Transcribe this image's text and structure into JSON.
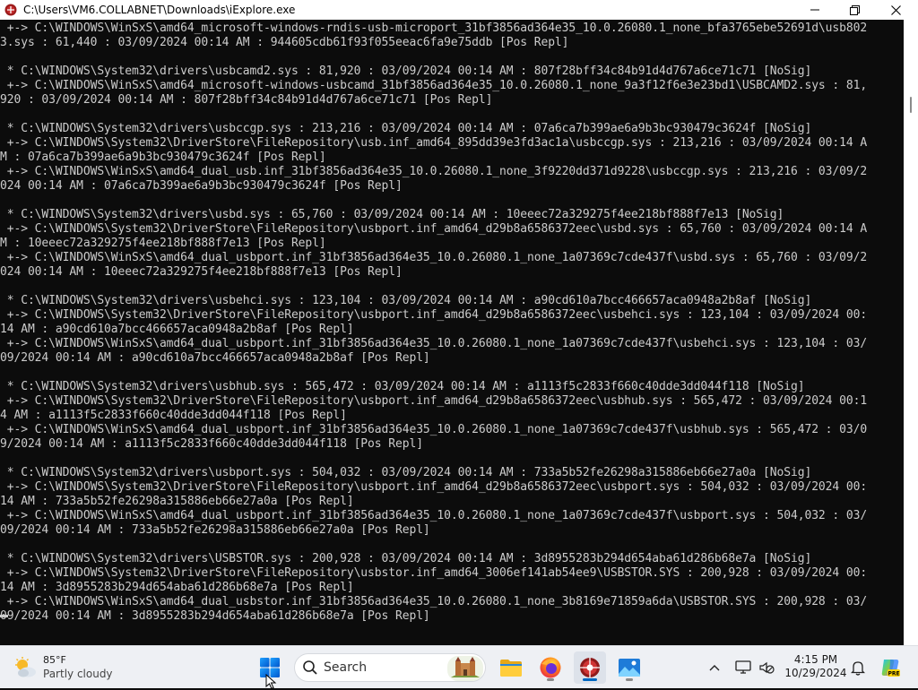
{
  "window": {
    "title": "C:\\Users\\VM6.COLLABNET\\Downloads\\iExplore.exe",
    "minimize_label": "minimize",
    "maximize_label": "maximize",
    "close_label": "close"
  },
  "console": {
    "lines": [
      " +-> C:\\WINDOWS\\WinSxS\\amd64_microsoft-windows-rndis-usb-microport_31bf3856ad364e35_10.0.26080.1_none_bfa3765ebe52691d\\usb802",
      "3.sys : 61,440 : 03/09/2024 00:14 AM : 944605cdb61f93f055eeac6fa9e75ddb [Pos Repl]",
      "",
      " * C:\\WINDOWS\\System32\\drivers\\usbcamd2.sys : 81,920 : 03/09/2024 00:14 AM : 807f28bff34c84b91d4d767a6ce71c71 [NoSig]",
      " +-> C:\\WINDOWS\\WinSxS\\amd64_microsoft-windows-usbcamd_31bf3856ad364e35_10.0.26080.1_none_9a3f12f6e3e23bd1\\USBCAMD2.sys : 81,",
      "920 : 03/09/2024 00:14 AM : 807f28bff34c84b91d4d767a6ce71c71 [Pos Repl]",
      "",
      " * C:\\WINDOWS\\System32\\drivers\\usbccgp.sys : 213,216 : 03/09/2024 00:14 AM : 07a6ca7b399ae6a9b3bc930479c3624f [NoSig]",
      " +-> C:\\WINDOWS\\System32\\DriverStore\\FileRepository\\usb.inf_amd64_895dd39e3fd3ac1a\\usbccgp.sys : 213,216 : 03/09/2024 00:14 A",
      "M : 07a6ca7b399ae6a9b3bc930479c3624f [Pos Repl]",
      " +-> C:\\WINDOWS\\WinSxS\\amd64_dual_usb.inf_31bf3856ad364e35_10.0.26080.1_none_3f9220dd371d9228\\usbccgp.sys : 213,216 : 03/09/2",
      "024 00:14 AM : 07a6ca7b399ae6a9b3bc930479c3624f [Pos Repl]",
      "",
      " * C:\\WINDOWS\\System32\\drivers\\usbd.sys : 65,760 : 03/09/2024 00:14 AM : 10eeec72a329275f4ee218bf888f7e13 [NoSig]",
      " +-> C:\\WINDOWS\\System32\\DriverStore\\FileRepository\\usbport.inf_amd64_d29b8a6586372eec\\usbd.sys : 65,760 : 03/09/2024 00:14 A",
      "M : 10eeec72a329275f4ee218bf888f7e13 [Pos Repl]",
      " +-> C:\\WINDOWS\\WinSxS\\amd64_dual_usbport.inf_31bf3856ad364e35_10.0.26080.1_none_1a07369c7cde437f\\usbd.sys : 65,760 : 03/09/2",
      "024 00:14 AM : 10eeec72a329275f4ee218bf888f7e13 [Pos Repl]",
      "",
      " * C:\\WINDOWS\\System32\\drivers\\usbehci.sys : 123,104 : 03/09/2024 00:14 AM : a90cd610a7bcc466657aca0948a2b8af [NoSig]",
      " +-> C:\\WINDOWS\\System32\\DriverStore\\FileRepository\\usbport.inf_amd64_d29b8a6586372eec\\usbehci.sys : 123,104 : 03/09/2024 00:",
      "14 AM : a90cd610a7bcc466657aca0948a2b8af [Pos Repl]",
      " +-> C:\\WINDOWS\\WinSxS\\amd64_dual_usbport.inf_31bf3856ad364e35_10.0.26080.1_none_1a07369c7cde437f\\usbehci.sys : 123,104 : 03/",
      "09/2024 00:14 AM : a90cd610a7bcc466657aca0948a2b8af [Pos Repl]",
      "",
      " * C:\\WINDOWS\\System32\\drivers\\usbhub.sys : 565,472 : 03/09/2024 00:14 AM : a1113f5c2833f660c40dde3dd044f118 [NoSig]",
      " +-> C:\\WINDOWS\\System32\\DriverStore\\FileRepository\\usbport.inf_amd64_d29b8a6586372eec\\usbhub.sys : 565,472 : 03/09/2024 00:1",
      "4 AM : a1113f5c2833f660c40dde3dd044f118 [Pos Repl]",
      " +-> C:\\WINDOWS\\WinSxS\\amd64_dual_usbport.inf_31bf3856ad364e35_10.0.26080.1_none_1a07369c7cde437f\\usbhub.sys : 565,472 : 03/0",
      "9/2024 00:14 AM : a1113f5c2833f660c40dde3dd044f118 [Pos Repl]",
      "",
      " * C:\\WINDOWS\\System32\\drivers\\usbport.sys : 504,032 : 03/09/2024 00:14 AM : 733a5b52fe26298a315886eb66e27a0a [NoSig]",
      " +-> C:\\WINDOWS\\System32\\DriverStore\\FileRepository\\usbport.inf_amd64_d29b8a6586372eec\\usbport.sys : 504,032 : 03/09/2024 00:",
      "14 AM : 733a5b52fe26298a315886eb66e27a0a [Pos Repl]",
      " +-> C:\\WINDOWS\\WinSxS\\amd64_dual_usbport.inf_31bf3856ad364e35_10.0.26080.1_none_1a07369c7cde437f\\usbport.sys : 504,032 : 03/",
      "09/2024 00:14 AM : 733a5b52fe26298a315886eb66e27a0a [Pos Repl]",
      "",
      " * C:\\WINDOWS\\System32\\drivers\\USBSTOR.sys : 200,928 : 03/09/2024 00:14 AM : 3d8955283b294d654aba61d286b68e7a [NoSig]",
      " +-> C:\\WINDOWS\\System32\\DriverStore\\FileRepository\\usbstor.inf_amd64_3006ef141ab54ee9\\USBSTOR.SYS : 200,928 : 03/09/2024 00:",
      "14 AM : 3d8955283b294d654aba61d286b68e7a [Pos Repl]",
      " +-> C:\\WINDOWS\\WinSxS\\amd64_dual_usbstor.inf_31bf3856ad364e35_10.0.26080.1_none_3b8169e71859a6da\\USBSTOR.SYS : 200,928 : 03/",
      "09/2024 00:14 AM : 3d8955283b294d654aba61d286b68e7a [Pos Repl]"
    ]
  },
  "taskbar": {
    "weather": {
      "temp": "85°F",
      "desc": "Partly cloudy"
    },
    "search_placeholder": "Search",
    "clock": {
      "time": "4:15 PM",
      "date": "10/29/2024"
    },
    "pinned_icons": [
      "start-icon",
      "search-icon",
      "castle-widget-icon",
      "file-explorer-icon",
      "firefox-icon",
      "iexplore-icon",
      "photos-icon"
    ],
    "tray_icons": [
      "chevron-up-icon",
      "network-icon",
      "volume-muted-icon",
      "bell-icon",
      "copilot-icon"
    ]
  },
  "colors": {
    "console_bg": "#0c0c0c",
    "console_text": "#cccccc",
    "taskbar_bg": "#eef0f4",
    "accent": "#0067c0"
  }
}
